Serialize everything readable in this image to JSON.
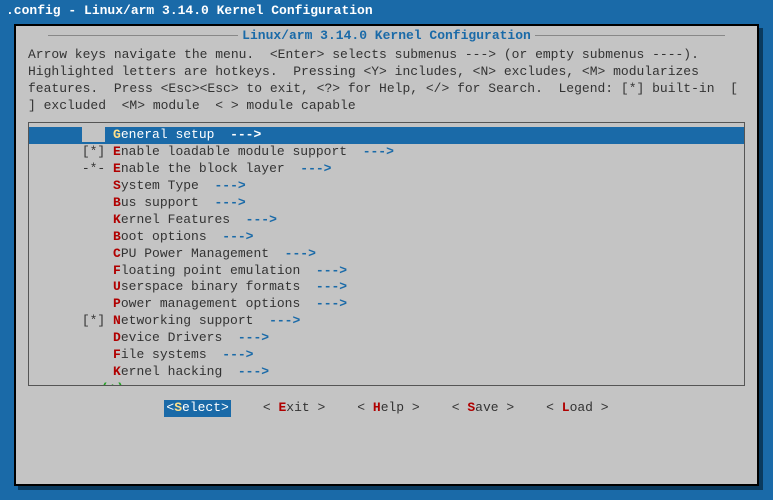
{
  "window_title": ".config - Linux/arm 3.14.0 Kernel Configuration",
  "main_title": "Linux/arm 3.14.0 Kernel Configuration",
  "help_text": "Arrow keys navigate the menu.  <Enter> selects submenus ---> (or empty submenus ----).  Highlighted letters are hotkeys.  Pressing <Y> includes, <N> excludes, <M> modularizes features.  Press <Esc><Esc> to exit, <?> for Help, </> for Search.  Legend: [*] built-in  [ ] excluded  <M> module  < > module capable",
  "menu": [
    {
      "sel": "   ",
      "hot": "G",
      "rest": "eneral setup  --->",
      "selected": true
    },
    {
      "sel": "[*]",
      "hot": "E",
      "rest": "nable loadable module support  --->"
    },
    {
      "sel": "-*-",
      "hot": "E",
      "rest": "nable the block layer  --->"
    },
    {
      "sel": "   ",
      "hot": "S",
      "rest": "ystem Type  --->"
    },
    {
      "sel": "   ",
      "hot": "B",
      "rest": "us support  --->"
    },
    {
      "sel": "   ",
      "hot": "K",
      "rest": "ernel Features  --->"
    },
    {
      "sel": "   ",
      "hot": "B",
      "rest": "oot options  --->"
    },
    {
      "sel": "   ",
      "hot": "C",
      "rest": "PU Power Management  --->"
    },
    {
      "sel": "   ",
      "hot": "F",
      "rest": "loating point emulation  --->"
    },
    {
      "sel": "   ",
      "hot": "U",
      "rest": "serspace binary formats  --->"
    },
    {
      "sel": "   ",
      "hot": "P",
      "rest": "ower management options  --->"
    },
    {
      "sel": "[*]",
      "hot": "N",
      "rest": "etworking support  --->"
    },
    {
      "sel": "   ",
      "hot": "D",
      "rest": "evice Drivers  --->"
    },
    {
      "sel": "   ",
      "hot": "F",
      "rest": "ile systems  --->"
    },
    {
      "sel": "   ",
      "hot": "K",
      "rest": "ernel hacking  --->"
    }
  ],
  "scroll_indicator": "v(+)",
  "buttons": [
    {
      "hot": "S",
      "rest": "elect",
      "selected": true
    },
    {
      "hot": "E",
      "rest": "xit"
    },
    {
      "hot": "H",
      "rest": "elp"
    },
    {
      "hot": "S",
      "rest": "ave"
    },
    {
      "hot": "L",
      "rest": "oad"
    }
  ]
}
